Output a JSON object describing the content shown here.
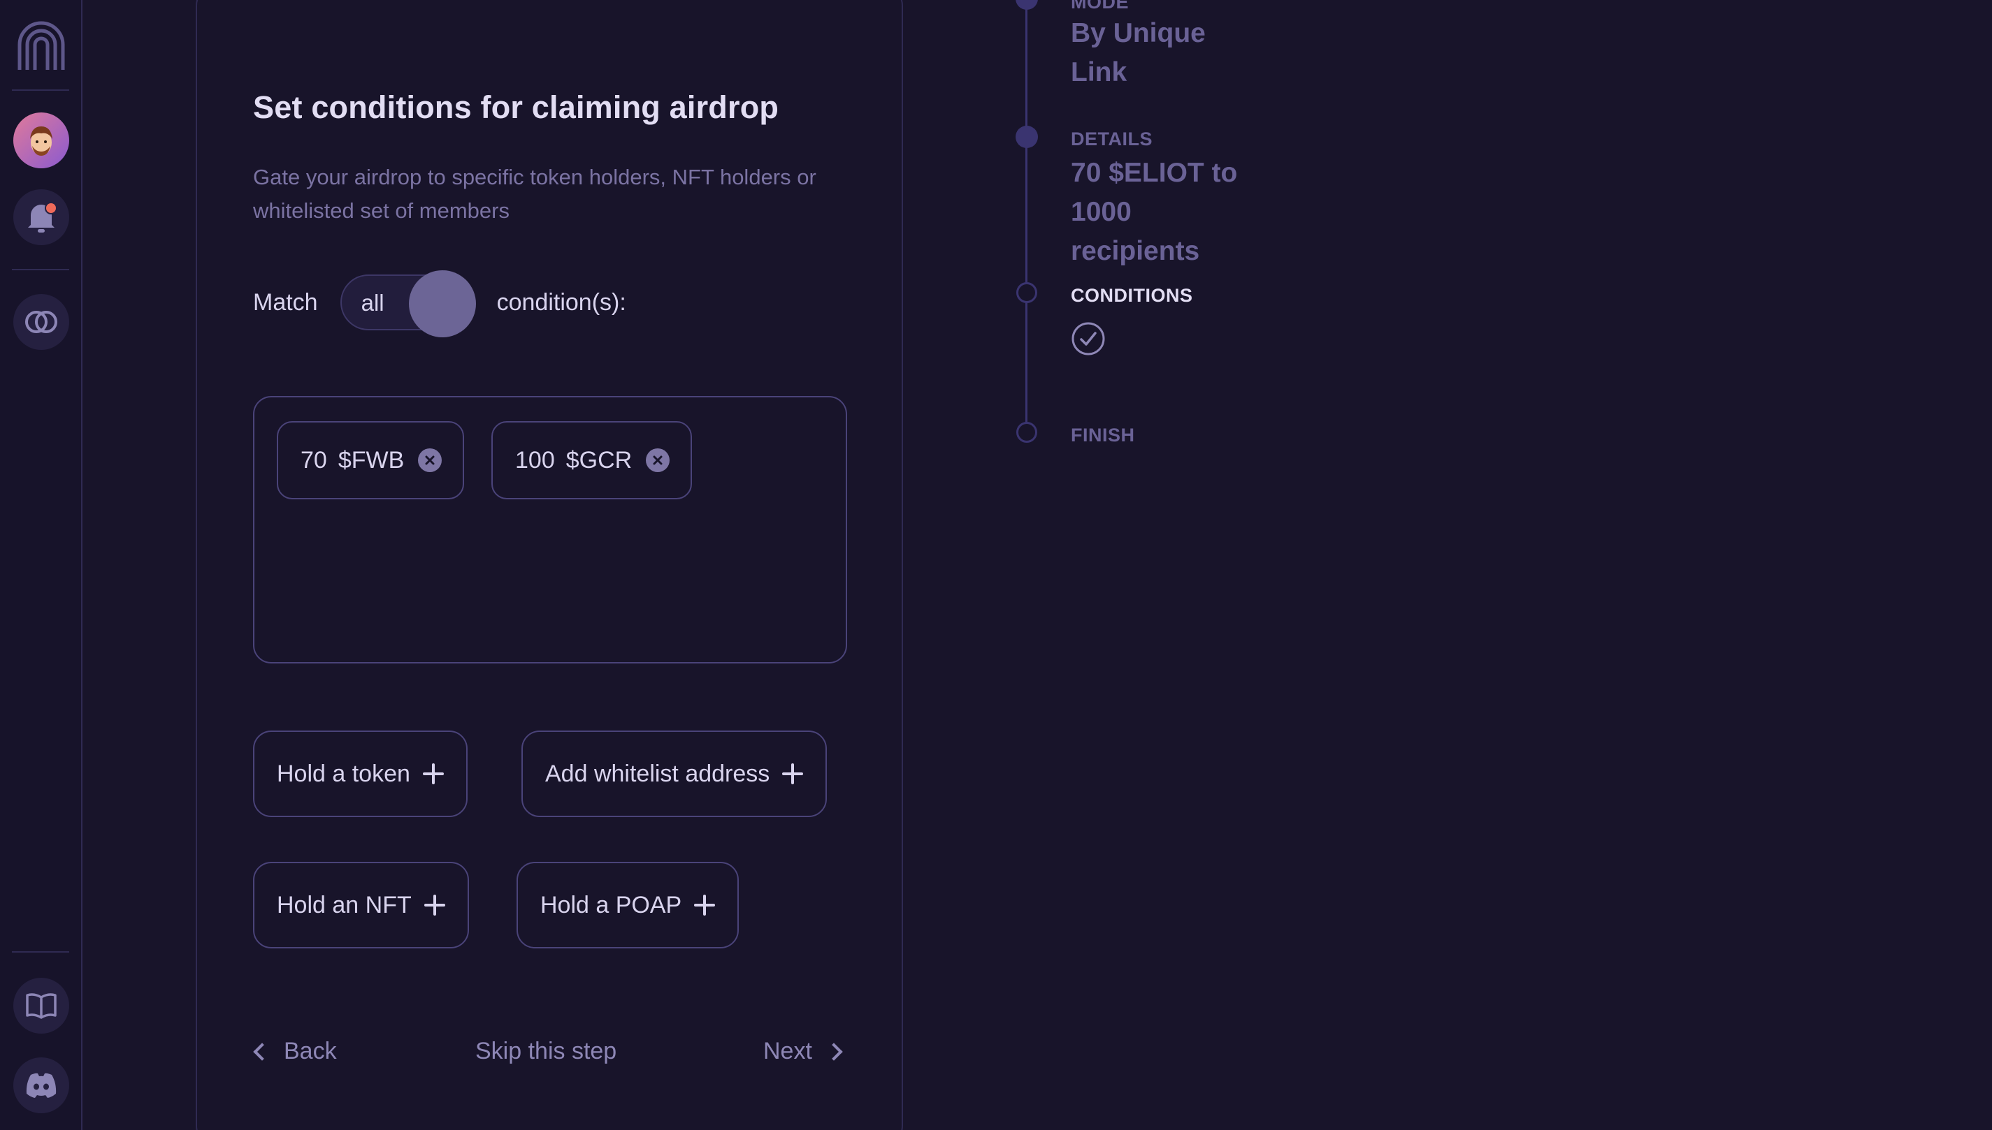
{
  "sidebar": {
    "logo_icon": "arch-logo-icon",
    "avatar_icon": "user-avatar",
    "notification_icon": "bell-icon",
    "explore_icon": "rings-icon",
    "docs_icon": "book-icon",
    "discord_icon": "discord-icon"
  },
  "card": {
    "title": "Set conditions for claiming airdrop",
    "subtitle": "Gate your airdrop to specific token holders, NFT holders or whitelisted set of members",
    "match_label": "Match",
    "toggle_value": "all",
    "conditions_label": "condition(s):",
    "chips": [
      {
        "amount": "70",
        "symbol": "$FWB"
      },
      {
        "amount": "100",
        "symbol": "$GCR"
      }
    ],
    "actions": {
      "hold_token": "Hold a token",
      "add_whitelist": "Add whitelist address",
      "hold_nft": "Hold an NFT",
      "hold_poap": "Hold a POAP"
    },
    "nav": {
      "back": "Back",
      "skip": "Skip this step",
      "next": "Next"
    }
  },
  "stepper": {
    "mode_label": "MODE",
    "mode_value_1": "By Unique",
    "mode_value_2": "Link",
    "details_label": "DETAILS",
    "details_value_1": "70 $ELIOT to",
    "details_value_2": "1000",
    "details_value_3": "recipients",
    "conditions_label": "CONDITIONS",
    "finish_label": "FINISH"
  },
  "colors": {
    "background": "#18142a",
    "accent": "#6c6596",
    "border": "#4a4379",
    "notification": "#ef6a5a"
  }
}
